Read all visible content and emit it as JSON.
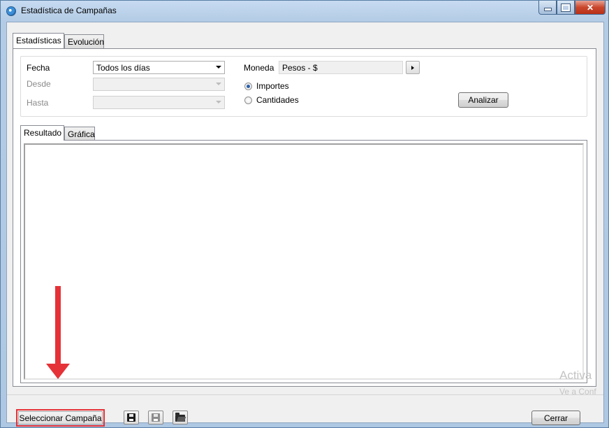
{
  "window": {
    "title": "Estadística de Campañas",
    "accent_color": "#e53238"
  },
  "main_tabs": [
    {
      "label": "Estadísticas",
      "active": true
    },
    {
      "label": "Evolución",
      "active": false
    }
  ],
  "filters": {
    "fecha_label": "Fecha",
    "fecha_value": "Todos los días",
    "desde_label": "Desde",
    "hasta_label": "Hasta",
    "moneda_label": "Moneda",
    "moneda_value": "Pesos - $",
    "radio_importes": "Importes",
    "radio_cantidades": "Cantidades",
    "selected_radio": "Importes",
    "analizar_label": "Analizar"
  },
  "result_tabs": [
    {
      "label": "Resultado",
      "active": true
    },
    {
      "label": "Gráfica",
      "active": false
    }
  ],
  "bottom": {
    "seleccionar_label": "Seleccionar Campaña",
    "cerrar_label": "Cerrar",
    "icons": [
      "save-icon",
      "save-disabled-icon",
      "open-folder-icon"
    ]
  },
  "watermark": {
    "line1": "Activa",
    "line2": "Ve a Conf"
  }
}
